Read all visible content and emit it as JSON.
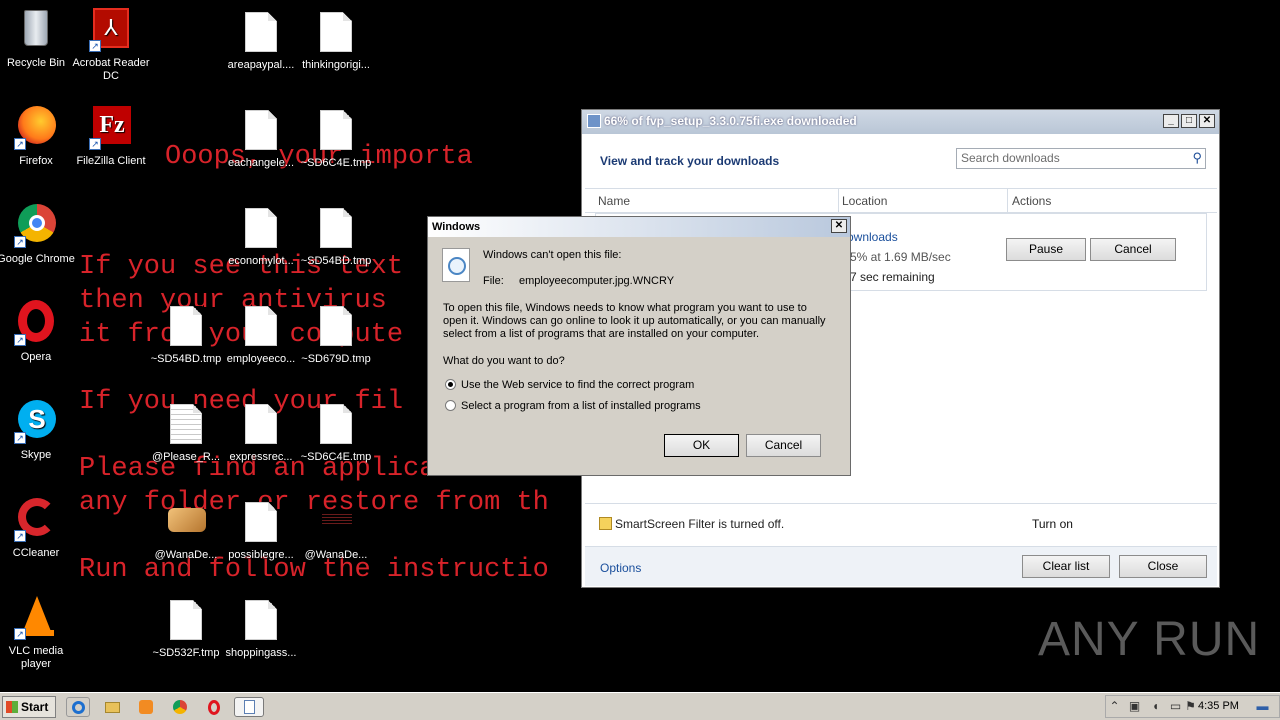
{
  "wallpaper": {
    "lines": [
      "Ooops, your importa",
      "If you see this text",
      "then your antivirus",
      "it from your compute",
      "If you need your fil",
      "Please find an application",
      "any folder or restore from th",
      "Run and follow the instructio"
    ]
  },
  "desktop_icons": [
    {
      "label": "Recycle Bin",
      "icon": "recycle-bin-icon"
    },
    {
      "label": "Acrobat Reader DC",
      "icon": "acrobat-icon"
    },
    {
      "label": "Firefox",
      "icon": "firefox-icon"
    },
    {
      "label": "FileZilla Client",
      "icon": "filezilla-icon"
    },
    {
      "label": "Google Chrome",
      "icon": "chrome-icon"
    },
    {
      "label": "Opera",
      "icon": "opera-icon"
    },
    {
      "label": "Skype",
      "icon": "skype-icon"
    },
    {
      "label": "CCleaner",
      "icon": "ccleaner-icon"
    },
    {
      "label": "VLC media player",
      "icon": "vlc-icon"
    },
    {
      "label": "areapaypal....",
      "icon": "file-icon"
    },
    {
      "label": "thinkingorigi...",
      "icon": "file-icon"
    },
    {
      "label": "eachangele...",
      "icon": "file-icon"
    },
    {
      "label": "~SD6C4E.tmp",
      "icon": "file-icon"
    },
    {
      "label": "economylot...",
      "icon": "file-icon"
    },
    {
      "label": "~SD54BD.tmp",
      "icon": "file-icon"
    },
    {
      "label": "~SD54BD.tmp",
      "icon": "file-icon"
    },
    {
      "label": "employeeco...",
      "icon": "file-icon"
    },
    {
      "label": "~SD679D.tmp",
      "icon": "file-icon"
    },
    {
      "label": "@Please_R...",
      "icon": "text-file-icon"
    },
    {
      "label": "expressrec...",
      "icon": "file-icon"
    },
    {
      "label": "~SD6C4E.tmp",
      "icon": "file-icon"
    },
    {
      "label": "@WanaDe...",
      "icon": "wanadecryptor-icon"
    },
    {
      "label": "possiblegre...",
      "icon": "file-icon"
    },
    {
      "label": "@WanaDe...",
      "icon": "wallpaper-file-icon"
    },
    {
      "label": "~SD532F.tmp",
      "icon": "file-icon"
    },
    {
      "label": "shoppingass...",
      "icon": "file-icon"
    }
  ],
  "downloads": {
    "window_title": "66% of fvp_setup_3.3.0.75fi.exe downloaded",
    "header": "View and track your downloads",
    "search_placeholder": "Search downloads",
    "columns": [
      "Name",
      "Location",
      "Actions"
    ],
    "item": {
      "location": "ownloads",
      "speed": "5% at 1.69 MB/sec",
      "remaining": "7 sec remaining",
      "pause": "Pause",
      "cancel": "Cancel"
    },
    "smartscreen": "SmartScreen Filter is turned off.",
    "turn_on": "Turn on",
    "options": "Options",
    "clear_list": "Clear list",
    "close": "Close"
  },
  "dialog": {
    "title": "Windows",
    "headline": "Windows can't open this file:",
    "file_label": "File:",
    "file_name": "employeecomputer.jpg.WNCRY",
    "para1": "To open this file, Windows needs to know what program you want to use to",
    "para2": "open it. Windows can go online to look it up automatically, or you can manually",
    "para3": "select from a list of programs that are installed on your computer.",
    "question": "What do you want to do?",
    "option1": "Use the Web service to find the correct program",
    "option2": "Select a program from a list of installed programs",
    "selected_option": 1,
    "ok": "OK",
    "cancel": "Cancel"
  },
  "taskbar": {
    "start": "Start",
    "clock": "4:35 PM",
    "items": [
      "ie-icon",
      "explorer-icon",
      "media-player-icon",
      "chrome-icon",
      "opera-icon",
      "notepad-icon"
    ]
  },
  "watermark": "ANY RUN"
}
